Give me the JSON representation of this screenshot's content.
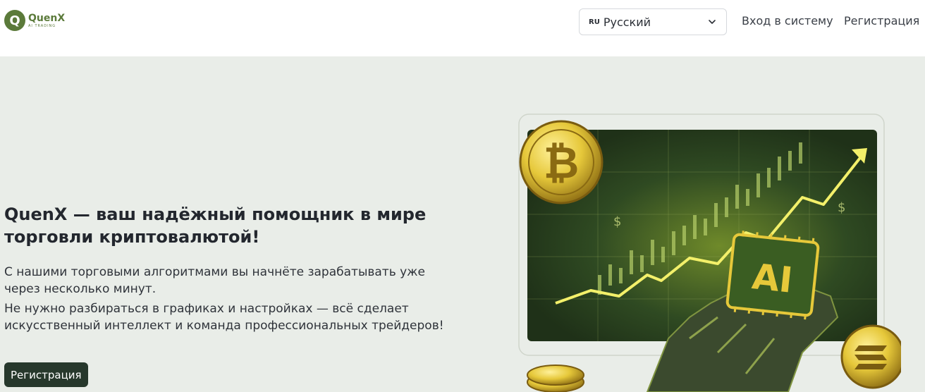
{
  "brand": {
    "badge": "Q",
    "name": "QuenX",
    "tagline": "AI TRADING"
  },
  "header": {
    "language": {
      "code": "RU",
      "label": "Русский"
    },
    "login": "Вход в систему",
    "register": "Регистрация"
  },
  "hero": {
    "title": "QuenX — ваш надёжный помощник в мире торговли криптовалютой!",
    "text1": "С нашими торговыми алгоритмами вы начнёте зарабатывать уже через несколько минут.",
    "text2": "Не нужно разбираться в графиках и настройках — всё сделает искусственный интеллект и команда профессиональных трейдеров!",
    "cta": "Регистрация",
    "art": {
      "chip_label": "AI",
      "coin_symbol": "₿",
      "dollar_symbol": "$",
      "bitcoin_icon": "bitcoin-coin-icon",
      "solana_icon": "solana-coin-icon"
    }
  },
  "colors": {
    "brand": "#5b7a3a",
    "hero_bg": "#e9ede8",
    "cta_bg": "#27382c",
    "gold": "#e6c83a",
    "neon": "#f3f06a"
  }
}
